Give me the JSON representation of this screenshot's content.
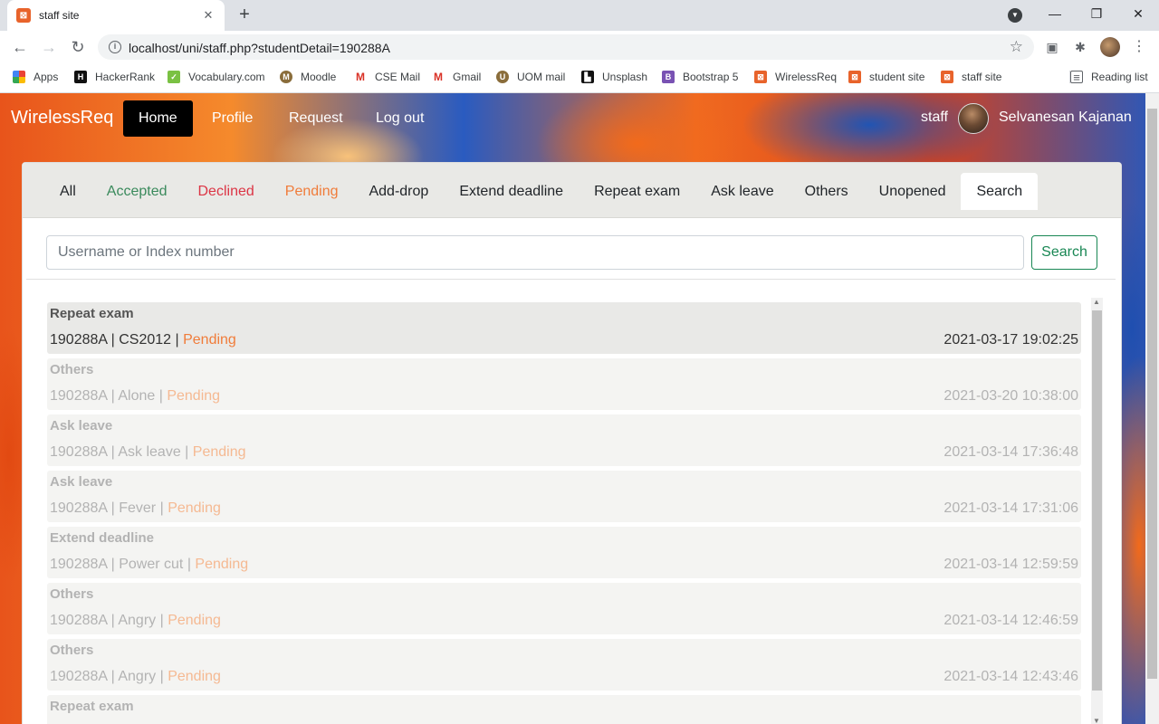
{
  "browser": {
    "tab_title": "staff site",
    "tab_close": "✕",
    "new_tab": "+",
    "url": "localhost/uni/staff.php?studentDetail=190288A",
    "window_controls": {
      "minimize": "—",
      "maximize": "❐",
      "close": "✕"
    },
    "bookmarks": [
      {
        "label": "Apps",
        "icon": "apps-grid-icon",
        "color": "#4285f4"
      },
      {
        "label": "HackerRank",
        "icon": "hackerrank-icon",
        "color": "#111111"
      },
      {
        "label": "Vocabulary.com",
        "icon": "vocabulary-icon",
        "color": "#7ac143"
      },
      {
        "label": "Moodle",
        "icon": "moodle-icon",
        "color": "#8a6d3b"
      },
      {
        "label": "CSE Mail",
        "icon": "gmail-icon",
        "color": "#d93025"
      },
      {
        "label": "Gmail",
        "icon": "gmail-icon",
        "color": "#d93025"
      },
      {
        "label": "UOM mail",
        "icon": "moodle-icon",
        "color": "#8a6d3b"
      },
      {
        "label": "Unsplash",
        "icon": "unsplash-icon",
        "color": "#111111"
      },
      {
        "label": "Bootstrap 5",
        "icon": "bootstrap-icon",
        "color": "#7952b3"
      },
      {
        "label": "WirelessReq",
        "icon": "xampp-icon",
        "color": "#e8632b"
      },
      {
        "label": "student site",
        "icon": "xampp-icon",
        "color": "#e8632b"
      },
      {
        "label": "staff site",
        "icon": "xampp-icon",
        "color": "#e8632b"
      }
    ],
    "reading_list": "Reading list"
  },
  "navbar": {
    "brand": "WirelessReq",
    "items": [
      "Home",
      "Profile",
      "Request",
      "Log out"
    ],
    "active": "Home",
    "role": "staff",
    "user_name": "Selvanesan Kajanan"
  },
  "filters": {
    "tabs": [
      {
        "label": "All",
        "color": "#212529"
      },
      {
        "label": "Accepted",
        "color": "#3a8a5c"
      },
      {
        "label": "Declined",
        "color": "#dc3545"
      },
      {
        "label": "Pending",
        "color": "#f07c3a"
      },
      {
        "label": "Add-drop",
        "color": "#212529"
      },
      {
        "label": "Extend deadline",
        "color": "#212529"
      },
      {
        "label": "Repeat exam",
        "color": "#212529"
      },
      {
        "label": "Ask leave",
        "color": "#212529"
      },
      {
        "label": "Others",
        "color": "#212529"
      },
      {
        "label": "Unopened",
        "color": "#212529"
      },
      {
        "label": "Search",
        "color": "#212529"
      }
    ],
    "active": "Search"
  },
  "search": {
    "placeholder": "Username or Index number",
    "button": "Search"
  },
  "requests": [
    {
      "type": "Repeat exam",
      "index": "190288A",
      "subject": "CS2012",
      "status": "Pending",
      "datetime": "2021-03-17 19:02:25"
    },
    {
      "type": "Others",
      "index": "190288A",
      "subject": "Alone",
      "status": "Pending",
      "datetime": "2021-03-20 10:38:00"
    },
    {
      "type": "Ask leave",
      "index": "190288A",
      "subject": "Ask leave",
      "status": "Pending",
      "datetime": "2021-03-14 17:36:48"
    },
    {
      "type": "Ask leave",
      "index": "190288A",
      "subject": "Fever",
      "status": "Pending",
      "datetime": "2021-03-14 17:31:06"
    },
    {
      "type": "Extend deadline",
      "index": "190288A",
      "subject": "Power cut",
      "status": "Pending",
      "datetime": "2021-03-14 12:59:59"
    },
    {
      "type": "Others",
      "index": "190288A",
      "subject": "Angry",
      "status": "Pending",
      "datetime": "2021-03-14 12:46:59"
    },
    {
      "type": "Others",
      "index": "190288A",
      "subject": "Angry",
      "status": "Pending",
      "datetime": "2021-03-14 12:43:46"
    },
    {
      "type": "Repeat exam",
      "index": "",
      "subject": "",
      "status": "",
      "datetime": ""
    }
  ],
  "separator": " | "
}
